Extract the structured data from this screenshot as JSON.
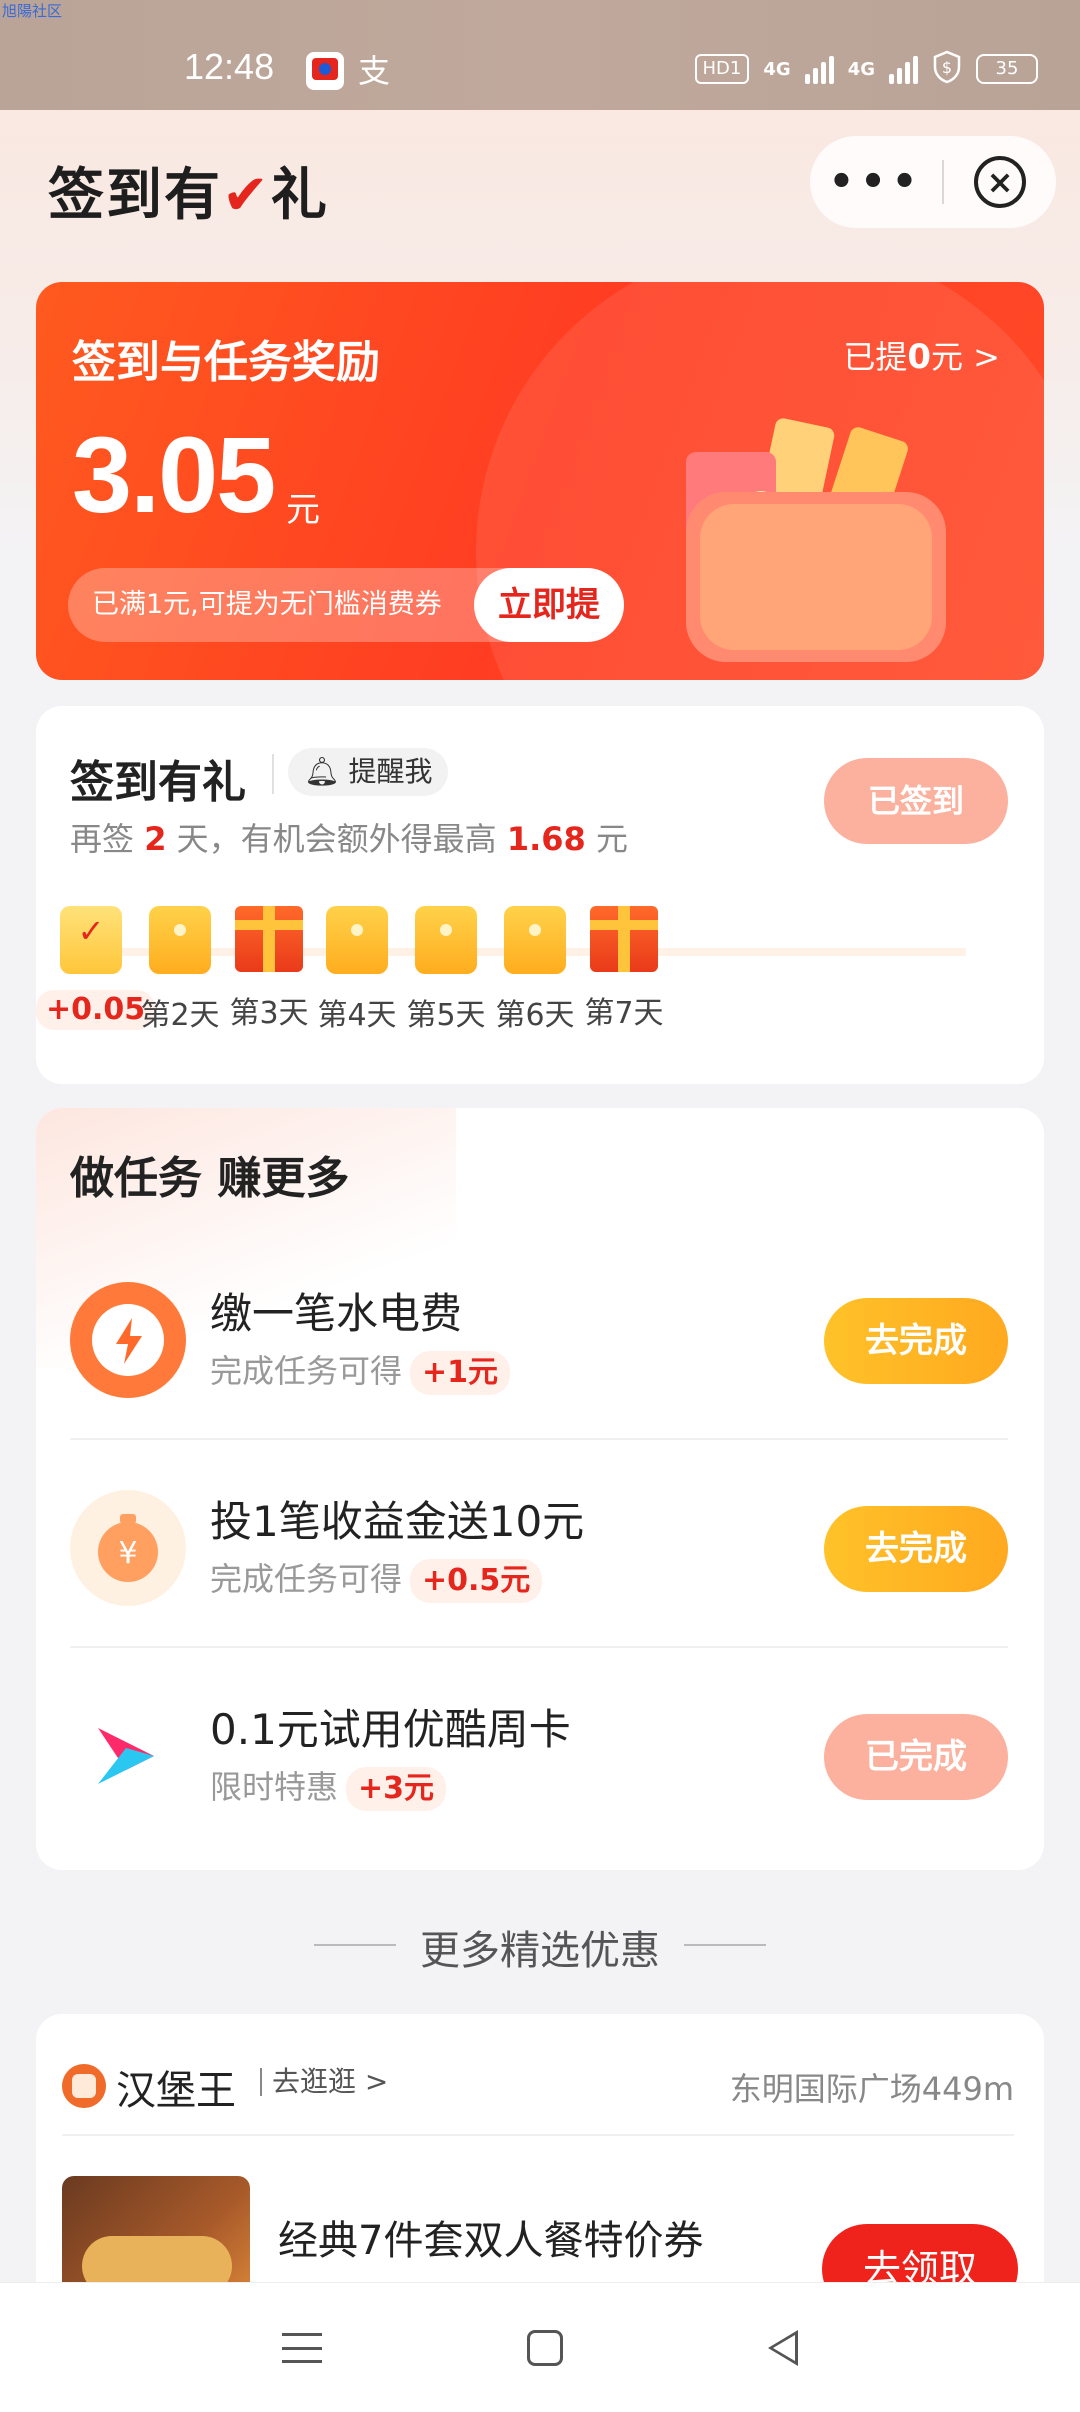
{
  "watermark": "旭陽社区",
  "status_bar": {
    "time": "12:48",
    "hd": "HD1",
    "net1": "4G",
    "net2": "4G",
    "battery": "35",
    "app_icons": [
      "app-badge-icon",
      "alipay-icon"
    ]
  },
  "header": {
    "brand_part1": "签到有",
    "brand_check": "✔",
    "brand_part2": "礼",
    "more": "•••",
    "close": "×"
  },
  "reward": {
    "title": "签到与任务奖励",
    "withdrawn_prefix": "已提",
    "withdrawn_value": "0",
    "withdrawn_suffix": "元 >",
    "amount": "3.05",
    "unit": "元",
    "hint": "已满1元,可提为无门槛消费券",
    "button": "立即提"
  },
  "checkin": {
    "title": "签到有礼",
    "remind": "提醒我",
    "sub_prefix": "再签",
    "sub_days": "2",
    "sub_mid": "天，有机会额外得最高",
    "sub_amount": "1.68",
    "sub_suffix": "元",
    "status_button": "已签到",
    "days": [
      {
        "label": "+0.05",
        "kind": "checked"
      },
      {
        "label": "第2天",
        "kind": "envelope"
      },
      {
        "label": "第3天",
        "kind": "gift"
      },
      {
        "label": "第4天",
        "kind": "envelope"
      },
      {
        "label": "第5天",
        "kind": "envelope"
      },
      {
        "label": "第6天",
        "kind": "envelope"
      },
      {
        "label": "第7天",
        "kind": "gift"
      }
    ]
  },
  "tasks": {
    "title": "做任务 赚更多",
    "items": [
      {
        "name": "缴一笔水电费",
        "desc": "完成任务可得",
        "bonus": "+1元",
        "button": "去完成",
        "state": "todo",
        "icon": "lightning-icon"
      },
      {
        "name": "投1笔收益金送10元",
        "desc": "完成任务可得",
        "bonus": "+0.5元",
        "button": "去完成",
        "state": "todo",
        "icon": "yuan-coin-icon"
      },
      {
        "name": "0.1元试用优酷周卡",
        "desc": "限时特惠",
        "bonus": "+3元",
        "button": "已完成",
        "state": "done",
        "icon": "youku-play-icon"
      }
    ]
  },
  "more_title": "更多精选优惠",
  "store": {
    "name": "汉堡王",
    "go": "去逛逛 >",
    "location": "东明国际广场449m",
    "deal": "经典7件套双人餐特价券",
    "button": "去领取"
  },
  "colors": {
    "accent_red": "#e5261c",
    "reward_orange": "#ff4a22",
    "todo_yellow": "#ffb423",
    "done_pink": "#fbb19e"
  }
}
